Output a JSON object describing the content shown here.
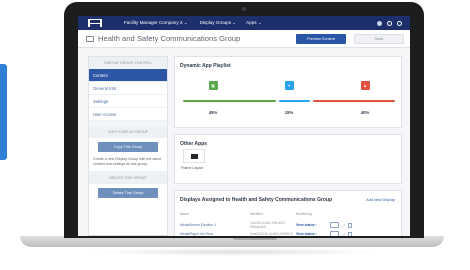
{
  "topbar": {
    "company": "Facility Manager Company 3 ⌄",
    "menu_display_groups": "Display Groups ⌄",
    "menu_apps": "Apps ⌄"
  },
  "titlebar": {
    "title": "Health and Safety Communications Group",
    "preview_label": "Preview Content",
    "save_label": "Save"
  },
  "sidebar": {
    "section_control": "Display Group Control",
    "items": [
      {
        "label": "Content"
      },
      {
        "label": "General Info"
      },
      {
        "label": "Settings"
      },
      {
        "label": "User Access"
      }
    ],
    "section_copy": "Copy Display Group",
    "copy_button": "Copy This Group",
    "copy_desc": "Create a new Display Group with the same content and settings as this group.",
    "section_delete": "Delete This Group",
    "delete_button": "Delete This Group"
  },
  "playlist": {
    "title": "Dynamic App Playlist",
    "items": [
      {
        "percent": "45%",
        "icon": "spreadsheet-icon",
        "color": "#5aa84a"
      },
      {
        "percent": "15%",
        "icon": "twitter-icon",
        "color": "#2aa3ef"
      },
      {
        "percent": "40%",
        "icon": "photo-icon",
        "color": "#e2533f"
      }
    ],
    "progress_colors": [
      "#5aa84a",
      "#2aa3ef",
      "#e2533f"
    ]
  },
  "other_apps": {
    "title": "Other Apps",
    "item_label": "Frame Layout"
  },
  "assigned": {
    "title": "Displays Assigned to Health and Safety Communications Group",
    "add_label": "Add New Display",
    "columns": [
      "Name",
      "Identifier",
      "Monitoring"
    ],
    "rows": [
      {
        "name": "MediaScreen Elevator 1",
        "identifier": "1ba76b1c4b1-996-6f22-f99aab4b6",
        "action": "View status ›"
      },
      {
        "name": "MediaPlayer 4th Floor",
        "identifier": "3aa00f223b-4c4bf1-06f9f1f2",
        "action": "View status ›"
      }
    ]
  }
}
